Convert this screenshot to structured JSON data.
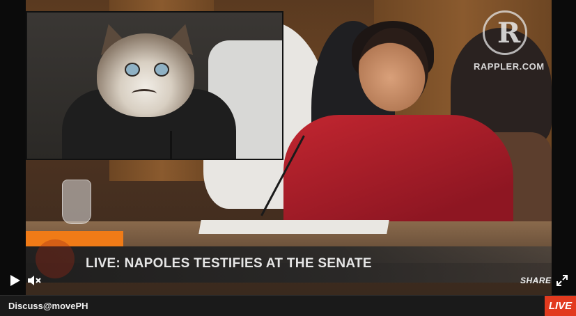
{
  "video": {
    "headline": "LIVE: NAPOLES TESTIFIES AT THE SENATE",
    "watermark_text": "RAPPLER.COM",
    "watermark_logo_letter": "R"
  },
  "controls": {
    "play_icon": "play-icon",
    "mute_icon": "volume-mute-icon",
    "share_label": "SHARE",
    "fullscreen_icon": "fullscreen-icon"
  },
  "bottom_bar": {
    "discuss_label": "Discuss@movePH",
    "live_label": "LIVE"
  },
  "colors": {
    "live_badge": "#e23a1e",
    "accent_orange": "#f07b17",
    "blazer_red": "#c22630"
  }
}
